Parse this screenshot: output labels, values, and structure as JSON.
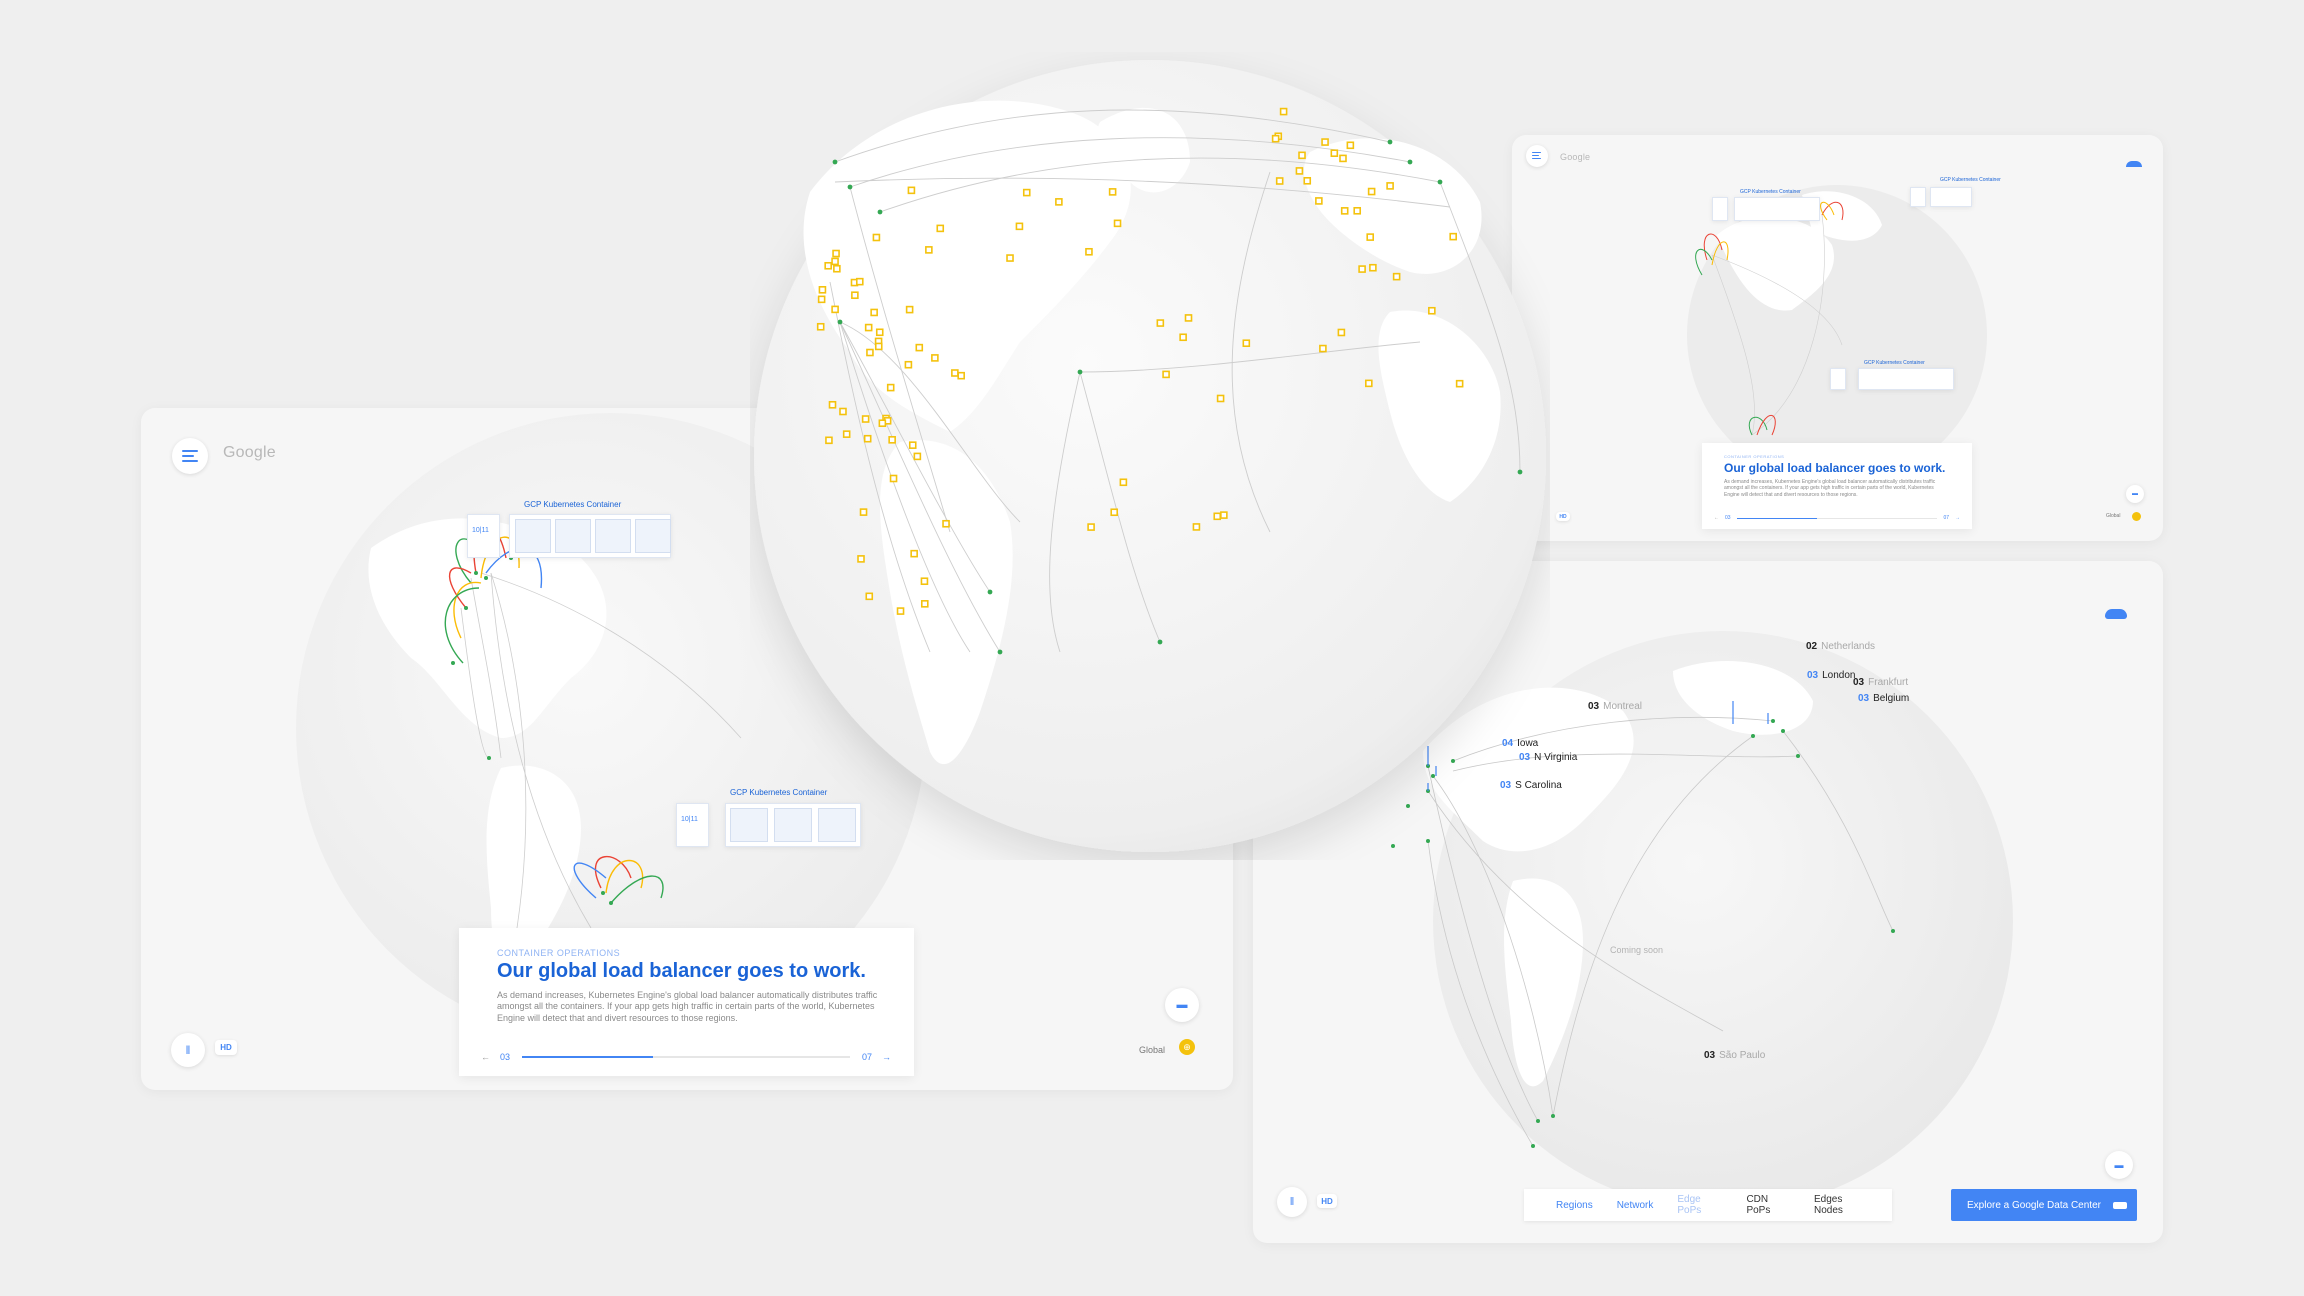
{
  "left_panel": {
    "logo": "Google",
    "container_label_1": "GCP Kubernetes Container",
    "container_label_2": "GCP Kubernetes Container",
    "node_badge": "10|11",
    "card": {
      "eyebrow": "CONTAINER OPERATIONS",
      "title": "Our global load balancer goes to work.",
      "body": "As demand increases, Kubernetes Engine's global load balancer automatically distributes traffic amongst all the containers. If your app gets high traffic in certain parts of the world, Kubernetes Engine will detect that and divert resources to those regions.",
      "page_current": "03",
      "page_total": "07",
      "progress": 0.4
    },
    "hd_label": "HD",
    "global_label": "Global"
  },
  "top_right_panel": {
    "logo": "Google",
    "container_label_1": "GCP Kubernetes Container",
    "container_label_2": "GCP Kubernetes Container",
    "container_label_3": "GCP Kubernetes Container",
    "card": {
      "eyebrow": "CONTAINER OPERATIONS",
      "title": "Our global load balancer goes to work.",
      "body": "As demand increases, Kubernetes Engine's global load balancer automatically distributes traffic amongst all the containers. If your app gets high traffic in certain parts of the world, Kubernetes Engine will detect that and divert resources to those regions.",
      "page_current": "03",
      "page_total": "07",
      "progress": 0.4
    },
    "hd_label": "HD",
    "global_label": "Global"
  },
  "bottom_right_panel": {
    "regions": [
      {
        "count": "02",
        "name": "Netherlands",
        "style": "muted"
      },
      {
        "count": "03",
        "name": "London",
        "style": "dark"
      },
      {
        "count": "03",
        "name": "Frankfurt",
        "style": "muted"
      },
      {
        "count": "03",
        "name": "Belgium",
        "style": "dark"
      },
      {
        "count": "03",
        "name": "Montreal",
        "style": "muted"
      },
      {
        "count": "04",
        "name": "Iowa",
        "style": "dark"
      },
      {
        "count": "03",
        "name": "N Virginia",
        "style": "dark"
      },
      {
        "count": "03",
        "name": "S Carolina",
        "style": "dark"
      },
      {
        "count": "03",
        "name": "São Paulo",
        "style": "muted"
      }
    ],
    "coming_soon": "Coming soon",
    "tabs": [
      "Regions",
      "Network",
      "Edge PoPs",
      "CDN PoPs",
      "Edges Nodes"
    ],
    "cta_label": "Explore a Google Data Center",
    "hd_label": "HD"
  },
  "colors": {
    "accent": "#4285f4",
    "title_blue": "#1a63d6",
    "pop_yellow": "#f4c20d",
    "node_green": "#34a853",
    "arc_red": "#ea4335",
    "background": "#efefef"
  }
}
